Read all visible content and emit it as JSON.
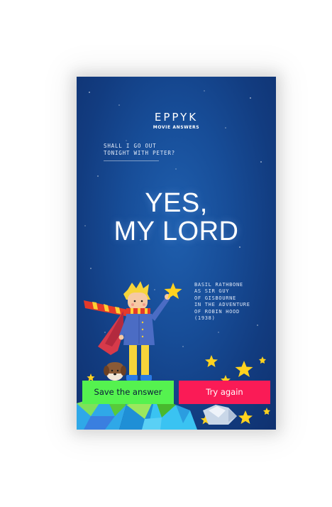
{
  "app": {
    "brand": "EPPYK",
    "subtitle": "MOVIE ANSWERS"
  },
  "question": {
    "line1": "SHALL I GO OUT",
    "line2": "TONIGHT WITH PETER?"
  },
  "answer": {
    "line1": "YES,",
    "line2": "MY LORD"
  },
  "credit": {
    "lines": [
      "BASIL RATHBONE",
      "AS SIR GUY",
      "OF GISBOURNE",
      "IN THE ADVENTURE",
      "OF ROBIN HOOD",
      "(1938)"
    ]
  },
  "buttons": {
    "save_label": "Save the answer",
    "retry_label": "Try again"
  },
  "colors": {
    "background": "#174d98",
    "save_button": "#55f24f",
    "retry_button": "#fa1b56",
    "star": "#ffd21f"
  }
}
